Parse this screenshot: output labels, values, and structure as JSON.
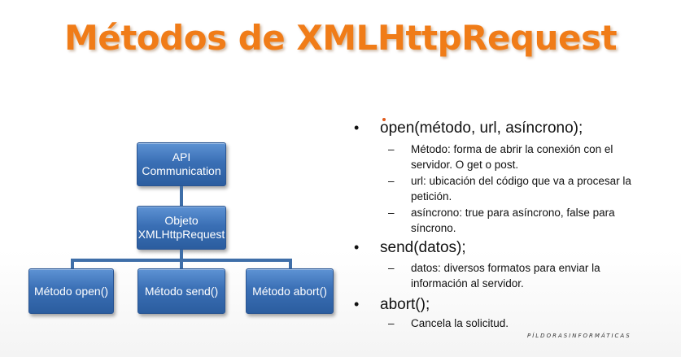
{
  "slide": {
    "title": "Métodos de XMLHttpRequest",
    "title_color": "#f07c18",
    "brand": "PÍLDORASINFORMÁTICAS"
  },
  "diagram": {
    "box_color": "#3a6fb5",
    "nodes": {
      "api": "API Communication",
      "objeto": "Objeto XMLHttpRequest",
      "open": "Método open()",
      "send": "Método send()",
      "abort": "Método abort()"
    }
  },
  "bullets": [
    {
      "marker": "•",
      "text": "open(método, url, asíncrono);",
      "sub": [
        {
          "marker": "–",
          "text": "Método: forma de abrir la conexión con el servidor. O get o post."
        },
        {
          "marker": "–",
          "text": "url: ubicación del código que va a procesar la petición."
        },
        {
          "marker": "–",
          "text": "asíncrono: true para asíncrono, false para síncrono."
        }
      ]
    },
    {
      "marker": "•",
      "text": "send(datos);",
      "sub": [
        {
          "marker": "–",
          "text": "datos: diversos formatos para enviar la información al servidor."
        }
      ]
    },
    {
      "marker": "•",
      "text": "abort();",
      "sub": [
        {
          "marker": "–",
          "text": "Cancela la solicitud."
        }
      ]
    }
  ]
}
